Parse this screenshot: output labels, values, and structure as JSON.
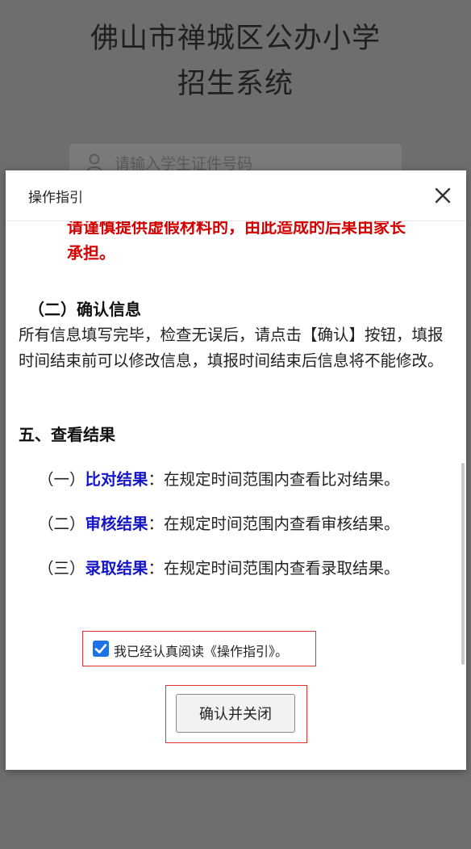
{
  "background": {
    "title_line1": "佛山市禅城区公办小学",
    "title_line2": "招生系统",
    "input_placeholder": "请输入学生证件号码",
    "input_icon": "user-icon"
  },
  "modal": {
    "title": "操作指引",
    "close_icon": "close-icon",
    "warning_cut": "请谨慎提供虚假材料的，由此造成的后果由家长",
    "warning_end": "承担。",
    "confirm_section": {
      "heading": "（二）确认信息",
      "text": "所有信息填写完毕，检查无误后，请点击【确认】按钮，填报时间结束前可以修改信息，填报时间结束后信息将不能修改。"
    },
    "results_section": {
      "heading": "五、查看结果",
      "items": [
        {
          "prefix": "（一）",
          "keyword": "比对结果",
          "text": "：在规定时间范围内查看比对结果。"
        },
        {
          "prefix": "（二）",
          "keyword": "审核结果",
          "text": "：在规定时间范围内查看审核结果。"
        },
        {
          "prefix": "（三）",
          "keyword": "录取结果",
          "text": "：在规定时间范围内查看录取结果。"
        }
      ]
    },
    "agree": {
      "checked": true,
      "label": "我已经认真阅读《操作指引》。"
    },
    "confirm_button": "确认并关闭"
  },
  "colors": {
    "warning": "#d40000",
    "keyword": "#1515c8",
    "checkbox": "#1a73e8",
    "highlight_border": "#e53333"
  }
}
